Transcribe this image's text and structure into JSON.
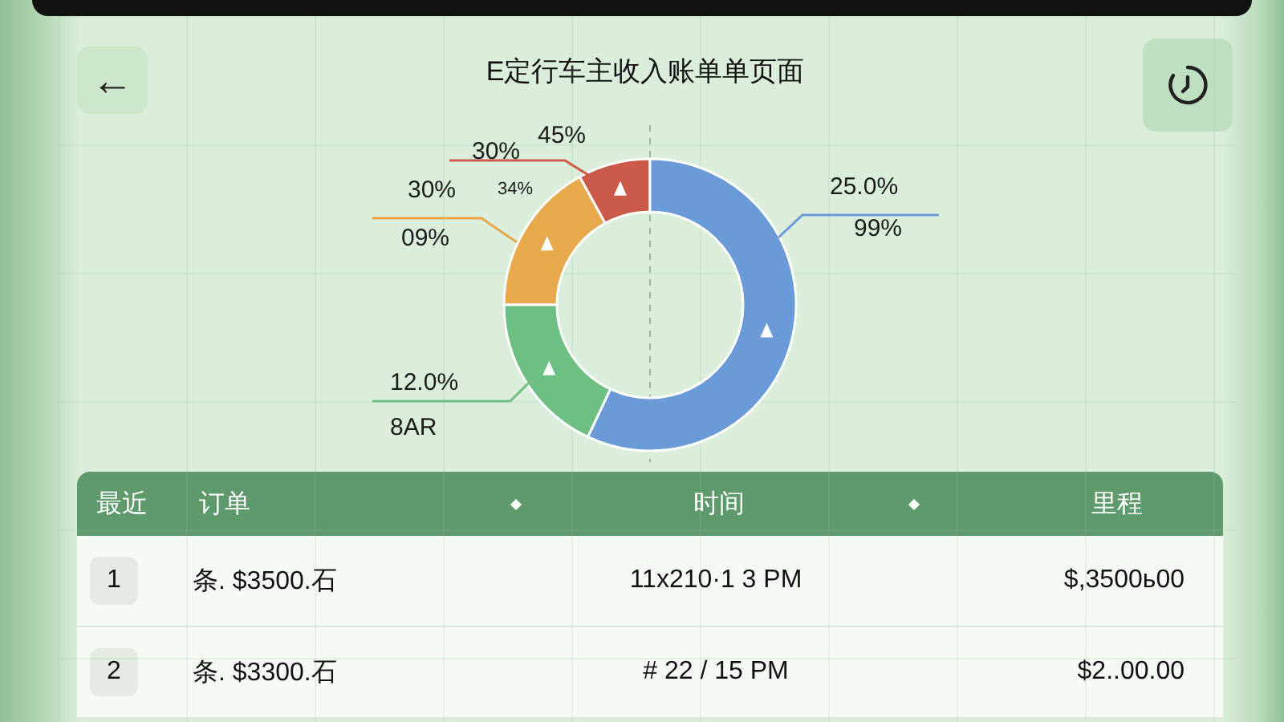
{
  "header": {
    "title": "E定行车主收入账单单页面",
    "back_icon": "←"
  },
  "donut": {
    "segments": [
      {
        "color": "#cc5a48",
        "labels": [
          "30%",
          "45%"
        ]
      },
      {
        "color": "#e8a84c",
        "labels": [
          "30%",
          "09%",
          "34%"
        ]
      },
      {
        "color": "#6a9bd8",
        "labels": [
          "25.0%",
          "99%"
        ]
      },
      {
        "color": "#6dbf84",
        "labels": [
          "12.0%",
          "8AR"
        ]
      }
    ]
  },
  "table": {
    "columns": [
      {
        "label": "最近",
        "sort": false
      },
      {
        "label": "订单",
        "sort": true
      },
      {
        "label": "时间",
        "sort": true
      },
      {
        "label": "里程",
        "sort": false
      }
    ],
    "rows": [
      {
        "index": "1",
        "order": "条. $3500.石",
        "time": "11x210·1 3 PM",
        "mileage": "$,3500ь00"
      },
      {
        "index": "2",
        "order": "条. $3300.石",
        "time": "# 22 / 15 PM",
        "mileage": "$2..00.00"
      }
    ]
  }
}
